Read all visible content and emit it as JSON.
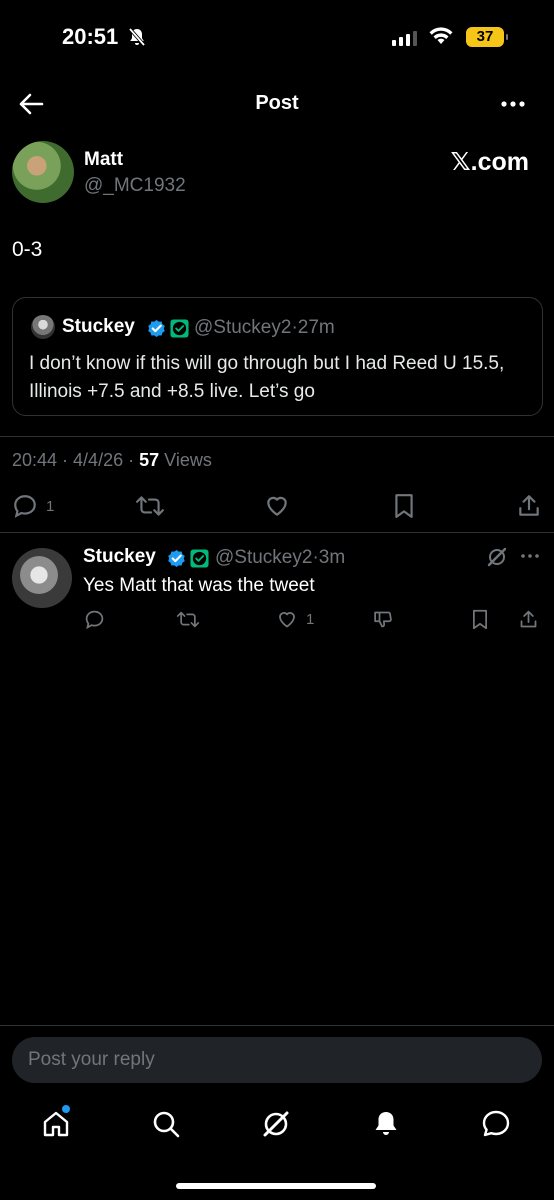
{
  "status_bar": {
    "time": "20:51",
    "battery": "37"
  },
  "header": {
    "title": "Post"
  },
  "post": {
    "author_name": "Matt",
    "author_handle": "@_MC1932",
    "source": "𝕏.com",
    "text": "0-3",
    "time": "20:44",
    "date": "4/4/26",
    "views_count": "57",
    "views_label": "Views",
    "reply_count": "1"
  },
  "quoted": {
    "name": "Stuckey",
    "handle": "@Stuckey2",
    "age": "27m",
    "text": "I don’t know if this will go through but I had Reed U 15.5, Illinois +7.5 and +8.5 live. Let’s go"
  },
  "reply": {
    "name": "Stuckey",
    "handle": "@Stuckey2",
    "age": "3m",
    "text": "Yes Matt that was the tweet",
    "like_count": "1"
  },
  "composer": {
    "placeholder": "Post your reply"
  },
  "colors": {
    "accent": "#1d9bf0",
    "muted": "#71767b",
    "border": "#2f3336",
    "verified_blue": "#1d9bf0",
    "verified_green": "#00ba7c",
    "battery": "#f5c518"
  },
  "tabs": [
    "home-icon",
    "search-icon",
    "grok-icon",
    "notifications-icon",
    "messages-icon"
  ]
}
